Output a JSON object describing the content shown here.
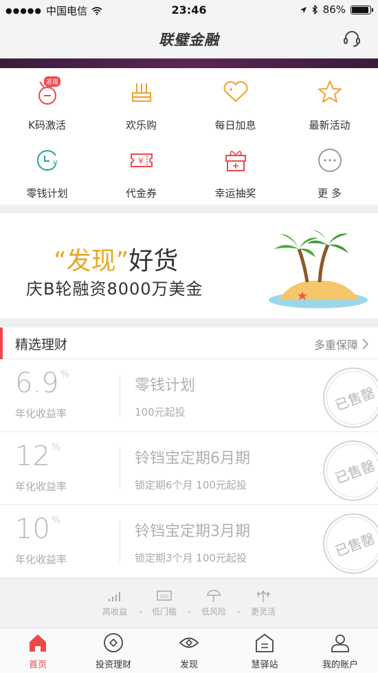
{
  "status_bar": {
    "signal": "●●●●●",
    "carrier": "中国电信",
    "time": "23:46",
    "battery": "86%",
    "battery_level": 0.86
  },
  "nav": {
    "title": "联璧金融"
  },
  "quick_menu": [
    {
      "label": "K码激活",
      "icon": "coupon-badge-icon",
      "badge": "返现"
    },
    {
      "label": "欢乐购",
      "icon": "shopping-bag-icon"
    },
    {
      "label": "每日加息",
      "icon": "heart-plus-icon"
    },
    {
      "label": "最新活动",
      "icon": "star-icon"
    },
    {
      "label": "零钱计划",
      "icon": "clock-yuan-icon"
    },
    {
      "label": "代金券",
      "icon": "voucher-icon"
    },
    {
      "label": "幸运抽奖",
      "icon": "gift-icon"
    },
    {
      "label": "更 多",
      "icon": "more-icon"
    }
  ],
  "promo": {
    "quote_open": "“",
    "highlight": "发现",
    "quote_close": "”",
    "suffix": "好货",
    "subtitle": "庆B轮融资8000万美金"
  },
  "section": {
    "title": "精选理财",
    "more": "多重保障"
  },
  "products": [
    {
      "rate": "6.9",
      "rate_unit": "%",
      "rate_label": "年化收益率",
      "name": "零钱计划",
      "desc": "100元起投",
      "status": "已售罄"
    },
    {
      "rate": "12",
      "rate_unit": "%",
      "rate_label": "年化收益率",
      "name": "铃铛宝定期6月期",
      "desc": "锁定期6个月  100元起投",
      "status": "已售罄"
    },
    {
      "rate": "10",
      "rate_unit": "%",
      "rate_label": "年化收益率",
      "name": "铃铛宝定期3月期",
      "desc": "锁定期3个月  100元起投",
      "status": "已售罄"
    }
  ],
  "features": [
    {
      "label": "高收益",
      "icon": "bar-chart-icon"
    },
    {
      "label": "低门槛",
      "icon": "banknote-icon"
    },
    {
      "label": "低风险",
      "icon": "umbrella-icon"
    },
    {
      "label": "更灵活",
      "icon": "arrows-icon"
    }
  ],
  "tabs": [
    {
      "label": "首页",
      "icon": "home-icon",
      "active": true
    },
    {
      "label": "投资理财",
      "icon": "invest-icon"
    },
    {
      "label": "发现",
      "icon": "eye-icon"
    },
    {
      "label": "慧驿站",
      "icon": "station-icon"
    },
    {
      "label": "我的账户",
      "icon": "user-icon"
    }
  ],
  "colors": {
    "accent": "#f0474c",
    "promo_gold": "#e8a824",
    "icon_orange": "#f0a030",
    "icon_teal": "#27a39a"
  }
}
